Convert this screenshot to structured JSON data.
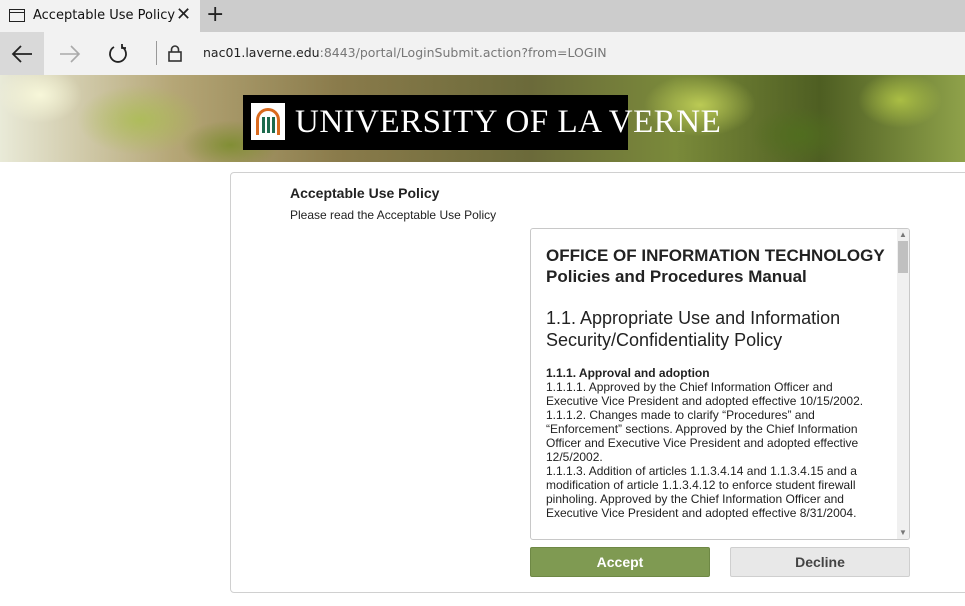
{
  "browser": {
    "tab_title": "Acceptable Use Policy",
    "close_glyph": "✕",
    "new_tab_glyph": "+",
    "url_host": "nac01.laverne.edu",
    "url_rest": ":8443/portal/LoginSubmit.action?from=LOGIN"
  },
  "banner": {
    "logo_text": "UNIVERSITY OF LA VERNE"
  },
  "page": {
    "heading": "Acceptable Use Policy",
    "subheading": "Please read the Acceptable Use Policy"
  },
  "policy": {
    "title": "OFFICE OF INFORMATION TECHNOLOGY",
    "subtitle": "Policies and Procedures Manual",
    "section": "1.1. Appropriate Use and Information Security/Confidentiality Policy",
    "subsection": "1.1.1. Approval and adoption",
    "items": [
      "1.1.1.1. Approved by the Chief Information Officer and Executive Vice President and adopted effective 10/15/2002.",
      "1.1.1.2. Changes made to clarify “Procedures” and “Enforcement” sections. Approved by the Chief Information Officer and Executive Vice President and adopted effective 12/5/2002.",
      "1.1.1.3. Addition of articles 1.1.3.4.14 and 1.1.3.4.15 and a modification of article 1.1.3.4.12 to enforce student firewall pinholing. Approved by the Chief Information Officer and Executive Vice President and adopted effective 8/31/2004."
    ]
  },
  "buttons": {
    "accept": "Accept",
    "decline": "Decline"
  },
  "colors": {
    "accept_bg": "#7f9a52",
    "logo_arch": "#d96a1e",
    "logo_column": "#1d6b4e"
  }
}
